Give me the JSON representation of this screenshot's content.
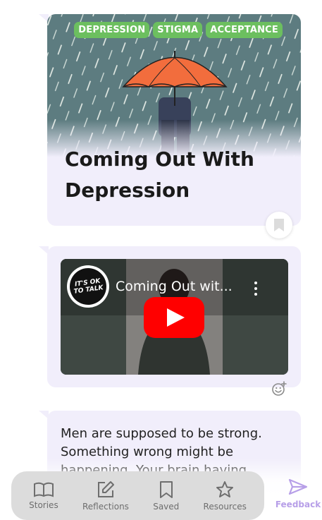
{
  "story_card": {
    "tags": [
      "DEPRESSION",
      "STIGMA",
      "ACCEPTANCE"
    ],
    "title": "Coming Out With Depression"
  },
  "video_card": {
    "channel_logo_text": "IT'S OK TO TALK",
    "video_title": "Coming Out wit..."
  },
  "text_card": {
    "text": "Men are supposed to be strong. Something wrong might be happening. Your brain having"
  },
  "bottom_nav": {
    "items": [
      {
        "label": "Stories",
        "icon": "book-icon"
      },
      {
        "label": "Reflections",
        "icon": "edit-icon"
      },
      {
        "label": "Saved",
        "icon": "bookmark-icon"
      },
      {
        "label": "Resources",
        "icon": "star-icon"
      }
    ],
    "feedback_label": "Feedback"
  },
  "colors": {
    "card_bg": "#f1eefb",
    "tag_green": "#6cbf5f",
    "accent_purple": "#b79fe8",
    "youtube_red": "#ff0000",
    "nav_bg": "#dcdcdc"
  }
}
